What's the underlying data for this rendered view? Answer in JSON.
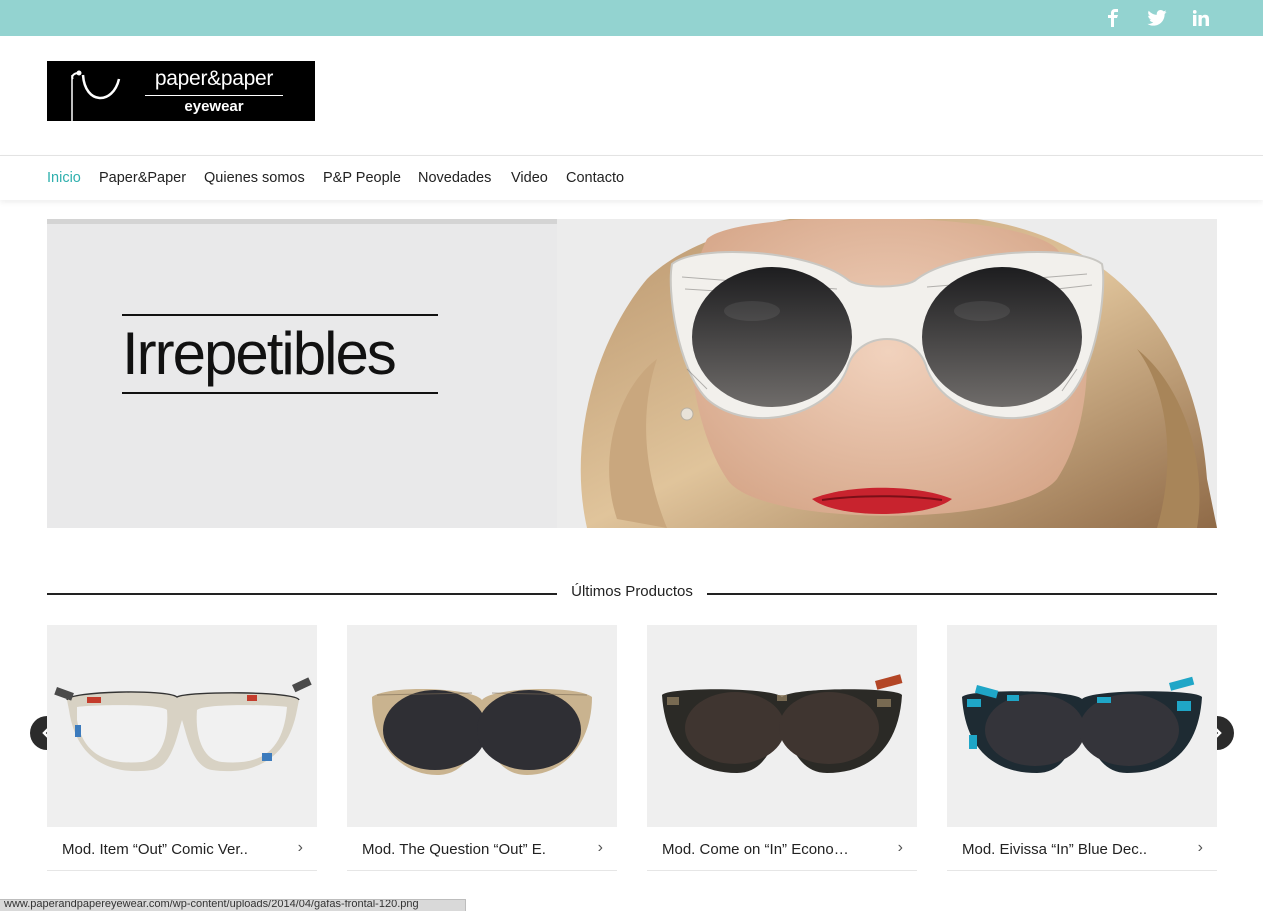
{
  "social": {
    "facebook_icon": "facebook-icon",
    "twitter_icon": "twitter-icon",
    "linkedin_icon": "linkedin-icon"
  },
  "logo": {
    "brand": "paper&paper",
    "sub": "eyewear"
  },
  "nav": {
    "items": [
      {
        "label": "Inicio",
        "active": true
      },
      {
        "label": "Paper&Paper"
      },
      {
        "label": "Quienes somos"
      },
      {
        "label": "P&P People"
      },
      {
        "label": "Novedades"
      },
      {
        "label": "Video"
      },
      {
        "label": "Contacto"
      }
    ]
  },
  "hero": {
    "headline": "Irrepetibles"
  },
  "products": {
    "section_title": "Últimos Productos",
    "items": [
      {
        "name": "Mod. Item “Out” Comic Ver.."
      },
      {
        "name": "Mod. The Question “Out” E."
      },
      {
        "name": "Mod. Come on “In” Econo…"
      },
      {
        "name": "Mod. Eivissa “In” Blue Dec.."
      }
    ],
    "prev_icon": "chevron-left-icon",
    "next_icon": "chevron-right-icon"
  },
  "statusbar": {
    "url": "www.paperandpapereyewear.com/wp-content/uploads/2014/04/gafas-frontal-120.png"
  },
  "colors": {
    "topbar": "#93d3d0",
    "accent": "#2fb0ae"
  }
}
